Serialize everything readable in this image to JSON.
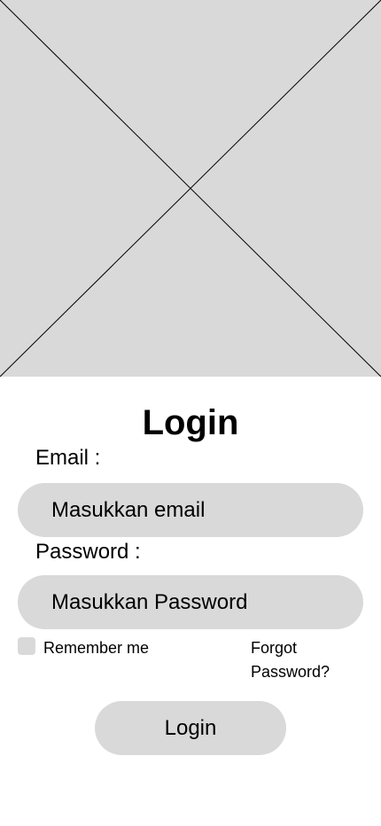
{
  "header": {
    "image_placeholder": "image-placeholder",
    "colors": {
      "placeholder_fill": "#d9d9d9",
      "cross_line": "#000000"
    }
  },
  "form": {
    "title": "Login",
    "email_label": "Email :",
    "email_placeholder": "Masukkan email",
    "password_label": "Password :",
    "password_placeholder": "Masukkan Password",
    "remember_label": "Remember me",
    "forgot_label": "Forgot Password?",
    "submit_label": "Login"
  },
  "colors": {
    "background": "#ffffff",
    "field_fill": "#d9d9d9",
    "text": "#000000"
  }
}
